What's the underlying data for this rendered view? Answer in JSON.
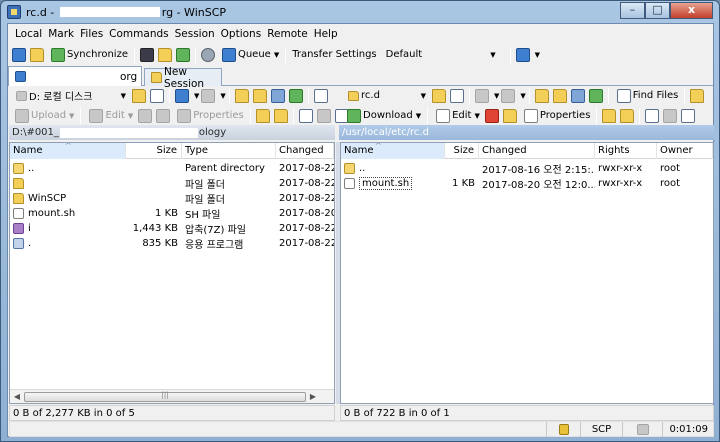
{
  "window": {
    "title_prefix": "rc.d - ",
    "title_suffix": "rg - WinSCP",
    "minimize": "–",
    "maximize": "□",
    "close": "x"
  },
  "menu": [
    "Local",
    "Mark",
    "Files",
    "Commands",
    "Session",
    "Options",
    "Remote",
    "Help"
  ],
  "toolbar": {
    "synchronize": "Synchronize",
    "queue": "Queue",
    "transfer_settings_label": "Transfer Settings",
    "transfer_settings_value": "Default"
  },
  "tabs": {
    "session_suffix": "org",
    "new_session": "New Session"
  },
  "left": {
    "drive": "D: 로컬 디스크",
    "upload": "Upload",
    "edit": "Edit",
    "properties": "Properties",
    "path_prefix": "D:\\#001_",
    "path_suffix": "ology",
    "columns": [
      "Name",
      "Size",
      "Type",
      "Changed"
    ],
    "rows": [
      {
        "name": "..",
        "size": "",
        "type": "Parent directory",
        "changed": "2017-08-22",
        "icon": "folder-up-icon",
        "redact": 0
      },
      {
        "name": "",
        "size": "",
        "type": "파일 폴더",
        "changed": "2017-08-22",
        "icon": "folder-icon",
        "redact": 80
      },
      {
        "name": "WinSCP",
        "size": "",
        "type": "파일 폴더",
        "changed": "2017-08-22",
        "icon": "folder-icon",
        "redact": 0
      },
      {
        "name": "mount.sh",
        "size": "1 KB",
        "type": "SH 파일",
        "changed": "2017-08-20",
        "icon": "document-icon",
        "redact": 0
      },
      {
        "name": "i",
        "size": "1,443 KB",
        "type": "압축(7Z) 파일",
        "changed": "2017-08-22",
        "icon": "archive-icon",
        "redact": 95
      },
      {
        "name": ".",
        "size": "835 KB",
        "type": "응용 프로그램",
        "changed": "2017-08-22",
        "icon": "application-icon",
        "redact": 95
      }
    ],
    "status": "0 B of 2,277 KB in 0 of 5"
  },
  "right": {
    "dir": "rc.d",
    "download": "Download",
    "edit": "Edit",
    "properties": "Properties",
    "find_files": "Find Files",
    "path": "/usr/local/etc/rc.d",
    "columns": [
      "Name",
      "Size",
      "Changed",
      "Rights",
      "Owner"
    ],
    "rows": [
      {
        "name": "..",
        "size": "",
        "changed": "2017-08-16 오전 2:15:...",
        "rights": "rwxr-xr-x",
        "owner": "root",
        "icon": "folder-up-icon"
      },
      {
        "name": "mount.sh",
        "size": "1 KB",
        "changed": "2017-08-20 오전 12:0...",
        "rights": "rwxr-xr-x",
        "owner": "root",
        "icon": "document-icon"
      }
    ],
    "status": "0 B of 722 B in 0 of 1"
  },
  "statusbar": {
    "protocol": "SCP",
    "time": "0:01:09"
  }
}
